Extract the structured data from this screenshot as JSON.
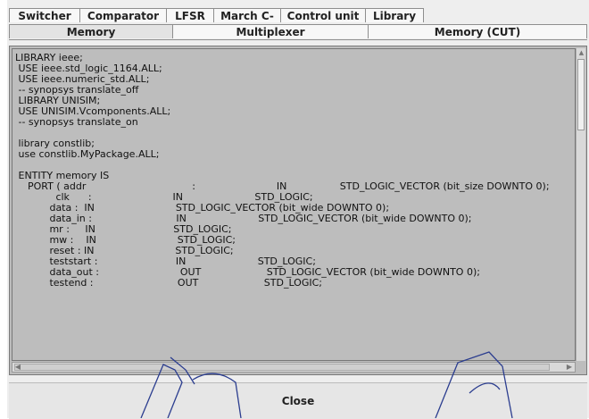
{
  "tabs_row1": [
    "Switcher",
    "Comparator",
    "LFSR",
    "March C-",
    "Control unit",
    "Library"
  ],
  "tabs_row2": [
    "Memory",
    "Multiplexer",
    "Memory (CUT)"
  ],
  "selected_tab": "Memory",
  "code_lines": [
    "LIBRARY ieee;",
    " USE ieee.std_logic_1164.ALL;",
    " USE ieee.numeric_std.ALL;",
    " -- synopsys translate_off",
    " LIBRARY UNISIM;",
    " USE UNISIM.Vcomponents.ALL;",
    " -- synopsys translate_on",
    "",
    " library constlib;",
    " use constlib.MyPackage.ALL;",
    "",
    " ENTITY memory IS",
    "    PORT ( addr                                  :                          IN                 STD_LOGIC_VECTOR (bit_size DOWNTO 0);",
    "             clk      :                          IN                       STD_LOGIC;",
    "           data :  IN                          STD_LOGIC_VECTOR (bit_wide DOWNTO 0);",
    "           data_in :                           IN                       STD_LOGIC_VECTOR (bit_wide DOWNTO 0);",
    "           mr :     IN                         STD_LOGIC;",
    "           mw :    IN                          STD_LOGIC;",
    "           reset : IN                          STD_LOGIC;",
    "           teststart :                         IN                       STD_LOGIC;",
    "           data_out :                          OUT                     STD_LOGIC_VECTOR (bit_wide DOWNTO 0);",
    "           testend :                           OUT                     STD_LOGIC;"
  ],
  "close_label": "Close"
}
